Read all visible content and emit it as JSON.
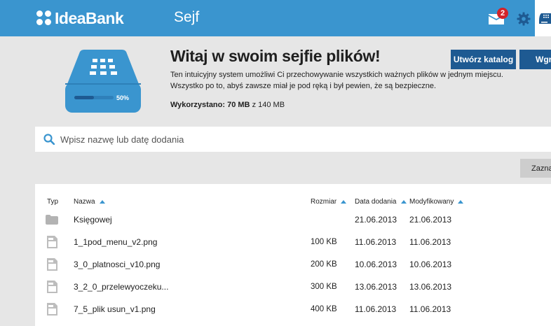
{
  "header": {
    "brand": "IdeaBank",
    "section": "Sejf",
    "mail_count": "2",
    "accent": "#3a95cf"
  },
  "hero": {
    "title": "Witaj w swoim sejfie plików!",
    "desc_line1": "Ten intuicyjny system umożliwi Ci przechowywanie wszystkich ważnych plików w jednym miejscu.",
    "desc_line2": "Wszystko po to, abyś zawsze miał je pod ręką i był pewien, że są bezpieczne.",
    "used_label": "Wykorzystano: 70 MB",
    "used_total": "z 140 MB",
    "usage_percent": "50%",
    "usage_fraction": 0.5
  },
  "actions": {
    "create_folder": "Utwórz katalog",
    "upload": "Wgraj",
    "select": "Zaznacz"
  },
  "search": {
    "placeholder": "Wpisz nazwę lub datę dodania"
  },
  "table": {
    "headers": {
      "type": "Typ",
      "name": "Nazwa",
      "size": "Rozmiar",
      "added": "Data dodania",
      "modified": "Modyfikowany"
    },
    "rows": [
      {
        "type": "folder-icon",
        "name": "Księgowej",
        "size": "",
        "added": "21.06.2013",
        "modified": "21.06.2013"
      },
      {
        "type": "file-icon",
        "name": "1_1pod_menu_v2.png",
        "size": "100 KB",
        "added": "11.06.2013",
        "modified": "11.06.2013"
      },
      {
        "type": "file-icon",
        "name": "3_0_platnosci_v10.png",
        "size": "200 KB",
        "added": "10.06.2013",
        "modified": "10.06.2013"
      },
      {
        "type": "file-icon",
        "name": "3_2_0_przelewyoczeku...",
        "size": "300 KB",
        "added": "13.06.2013",
        "modified": "13.06.2013"
      },
      {
        "type": "file-icon",
        "name": "7_5_plik usun_v1.png",
        "size": "400 KB",
        "added": "11.06.2013",
        "modified": "11.06.2013"
      }
    ]
  }
}
